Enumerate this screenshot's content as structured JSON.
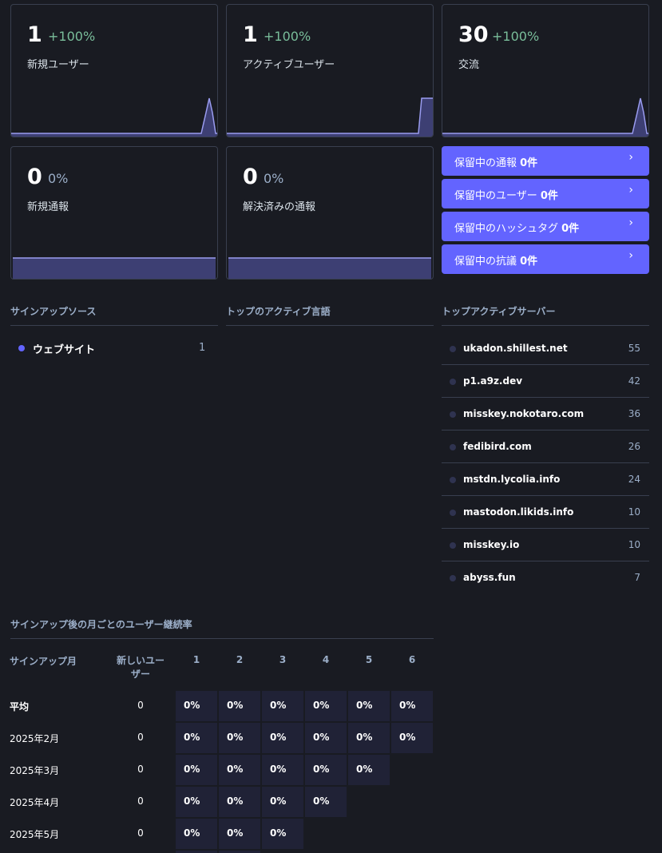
{
  "metrics": {
    "new_users": {
      "value": "1",
      "change": "+100%",
      "label": "新規ユーザー"
    },
    "active_users": {
      "value": "1",
      "change": "+100%",
      "label": "アクティブユーザー"
    },
    "interactions": {
      "value": "30",
      "change": "+100%",
      "label": "交流"
    },
    "new_reports": {
      "value": "0",
      "change": "0%",
      "label": "新規通報"
    },
    "resolved_reports": {
      "value": "0",
      "change": "0%",
      "label": "解決済みの通報"
    }
  },
  "pending": [
    {
      "prefix": "保留中の通報 ",
      "count": "0件"
    },
    {
      "prefix": "保留中のユーザー ",
      "count": "0件"
    },
    {
      "prefix": "保留中のハッシュタグ ",
      "count": "0件"
    },
    {
      "prefix": "保留中の抗議 ",
      "count": "0件"
    }
  ],
  "sections": {
    "signup_sources": "サインアップソース",
    "top_languages": "トップのアクティブ言語",
    "top_servers": "トップアクティブサーバー",
    "retention": "サインアップ後の月ごとのユーザー継続率"
  },
  "signup_sources": [
    {
      "name": "ウェブサイト",
      "value": "1"
    }
  ],
  "servers": [
    {
      "name": "ukadon.shillest.net",
      "value": "55"
    },
    {
      "name": "p1.a9z.dev",
      "value": "42"
    },
    {
      "name": "misskey.nokotaro.com",
      "value": "36"
    },
    {
      "name": "fedibird.com",
      "value": "26"
    },
    {
      "name": "mstdn.lycolia.info",
      "value": "24"
    },
    {
      "name": "mastodon.likids.info",
      "value": "10"
    },
    {
      "name": "misskey.io",
      "value": "10"
    },
    {
      "name": "abyss.fun",
      "value": "7"
    }
  ],
  "retention": {
    "headers": {
      "month": "サインアップ月",
      "new_users_1": "新しいユー",
      "new_users_2": "ザー",
      "m1": "1",
      "m2": "2",
      "m3": "3",
      "m4": "4",
      "m5": "5",
      "m6": "6"
    },
    "rows": [
      {
        "label": "平均",
        "new": "0",
        "cells": [
          "0%",
          "0%",
          "0%",
          "0%",
          "0%",
          "0%"
        ]
      },
      {
        "label": "2025年2月",
        "new": "0",
        "cells": [
          "0%",
          "0%",
          "0%",
          "0%",
          "0%",
          "0%"
        ]
      },
      {
        "label": "2025年3月",
        "new": "0",
        "cells": [
          "0%",
          "0%",
          "0%",
          "0%",
          "0%"
        ]
      },
      {
        "label": "2025年4月",
        "new": "0",
        "cells": [
          "0%",
          "0%",
          "0%",
          "0%"
        ]
      },
      {
        "label": "2025年5月",
        "new": "0",
        "cells": [
          "0%",
          "0%",
          "0%"
        ]
      }
    ]
  },
  "colors": {
    "accent": "#6364ff",
    "positive": "#79bd9a",
    "neutral": "#9baec8"
  },
  "icons": {
    "pending_chevron": "chevron-right-icon"
  }
}
